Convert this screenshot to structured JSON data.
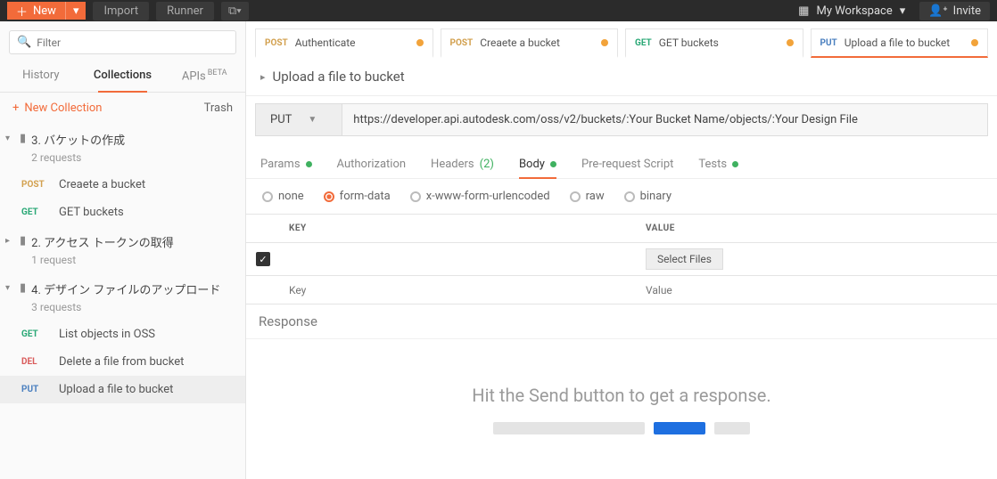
{
  "topbar": {
    "new_label": "New",
    "import_label": "Import",
    "runner_label": "Runner",
    "workspace_label": "My Workspace",
    "invite_label": "Invite"
  },
  "sidebar": {
    "filter_placeholder": "Filter",
    "tabs": {
      "history": "History",
      "collections": "Collections",
      "apis": "APIs",
      "apis_beta": "BETA"
    },
    "new_collection": "New Collection",
    "trash": "Trash",
    "folders": [
      {
        "name": "3. バケットの作成",
        "count": "2 requests",
        "requests": [
          {
            "method": "POST",
            "mclass": "m-post",
            "label": "Creaete a bucket"
          },
          {
            "method": "GET",
            "mclass": "m-get",
            "label": "GET buckets"
          }
        ]
      },
      {
        "name": "2. アクセス トークンの取得",
        "count": "1 request",
        "requests": []
      },
      {
        "name": "4. デザイン ファイルのアップロード",
        "count": "3 requests",
        "requests": [
          {
            "method": "GET",
            "mclass": "m-get",
            "label": "List objects in OSS"
          },
          {
            "method": "DEL",
            "mclass": "m-del",
            "label": "Delete a file from bucket"
          },
          {
            "method": "PUT",
            "mclass": "m-put",
            "label": "Upload a file to bucket"
          }
        ]
      }
    ]
  },
  "tabs": [
    {
      "method": "POST",
      "mclass": "m-post",
      "title": "Authenticate"
    },
    {
      "method": "POST",
      "mclass": "m-post",
      "title": "Creaete a bucket"
    },
    {
      "method": "GET",
      "mclass": "m-get",
      "title": "GET buckets"
    },
    {
      "method": "PUT",
      "mclass": "m-put",
      "title": "Upload a file to bucket"
    }
  ],
  "request": {
    "title": "Upload a file to bucket",
    "method": "PUT",
    "url": "https://developer.api.autodesk.com/oss/v2/buckets/:Your Bucket Name/objects/:Your Design File"
  },
  "subtabs": {
    "params": "Params",
    "authorization": "Authorization",
    "headers": "Headers",
    "headers_count": "(2)",
    "body": "Body",
    "prerequest": "Pre-request Script",
    "tests": "Tests"
  },
  "body_types": {
    "none": "none",
    "formdata": "form-data",
    "xwww": "x-www-form-urlencoded",
    "raw": "raw",
    "binary": "binary"
  },
  "kv": {
    "key_header": "KEY",
    "value_header": "VALUE",
    "select_files": "Select Files",
    "key_placeholder": "Key",
    "value_placeholder": "Value"
  },
  "response": {
    "header": "Response",
    "message": "Hit the Send button to get a response."
  }
}
